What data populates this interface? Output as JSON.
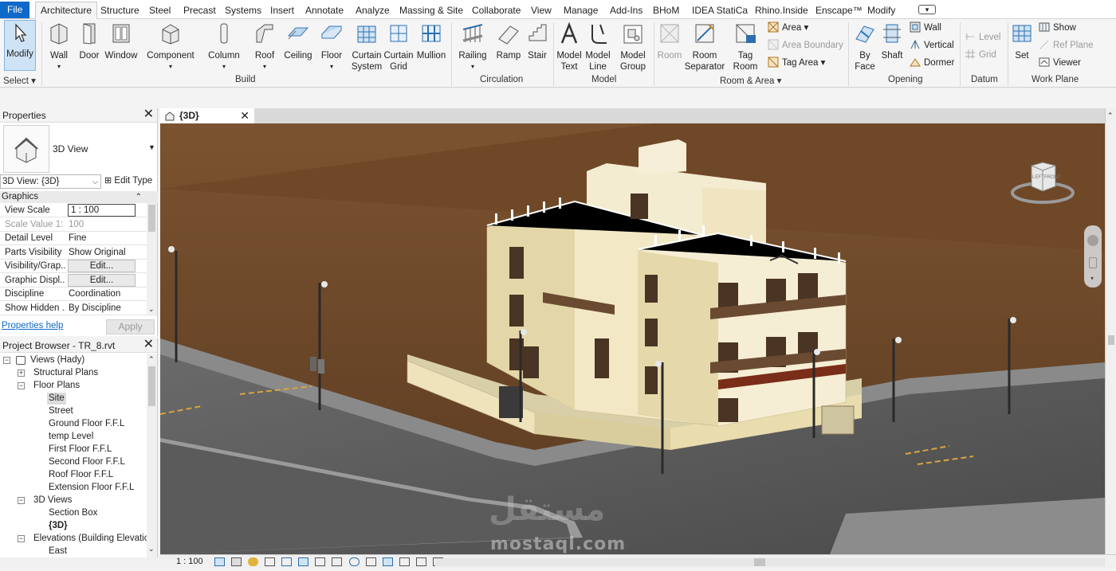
{
  "menubar": {
    "tabs": [
      "File",
      "Architecture",
      "Structure",
      "Steel",
      "Precast",
      "Systems",
      "Insert",
      "Annotate",
      "Analyze",
      "Massing & Site",
      "Collaborate",
      "View",
      "Manage",
      "Add-Ins",
      "BHoM",
      "IDEA StatiCa",
      "Rhino.Inside",
      "Enscape™",
      "Modify"
    ]
  },
  "ribbon": {
    "select": {
      "modify_label": "Modify",
      "select_label": "Select"
    },
    "build": {
      "title": "Build",
      "wall": "Wall",
      "door": "Door",
      "window": "Window",
      "component": "Component",
      "column": "Column",
      "roof": "Roof",
      "ceiling": "Ceiling",
      "floor": "Floor",
      "curtain_system_1": "Curtain",
      "curtain_system_2": "System",
      "curtain_grid_1": "Curtain",
      "curtain_grid_2": "Grid",
      "mullion": "Mullion"
    },
    "circulation": {
      "title": "Circulation",
      "railing": "Railing",
      "ramp": "Ramp",
      "stair": "Stair"
    },
    "model": {
      "title": "Model",
      "model_text_1": "Model",
      "model_text_2": "Text",
      "model_line_1": "Model",
      "model_line_2": "Line",
      "model_group_1": "Model",
      "model_group_2": "Group"
    },
    "room_area": {
      "title": "Room & Area",
      "room": "Room",
      "room_sep_1": "Room",
      "room_sep_2": "Separator",
      "tag_room_1": "Tag",
      "tag_room_2": "Room",
      "area": "Area",
      "area_boundary": "Area  Boundary",
      "tag_area": "Tag  Area"
    },
    "opening": {
      "title": "Opening",
      "by_face_1": "By",
      "by_face_2": "Face",
      "shaft": "Shaft",
      "wall": "Wall",
      "vertical": "Vertical",
      "dormer": "Dormer"
    },
    "datum": {
      "title": "Datum",
      "level": "Level",
      "grid": "Grid"
    },
    "work_plane": {
      "title": "Work Plane",
      "set": "Set",
      "show": "Show",
      "ref_plane": "Ref  Plane",
      "viewer": "Viewer"
    }
  },
  "properties": {
    "title": "Properties",
    "type_name": "3D View",
    "view_selector": "3D View: {3D}",
    "edit_type": "Edit Type",
    "section": "Graphics",
    "rows": [
      {
        "k": "View Scale",
        "v": "1 : 100",
        "kind": "input"
      },
      {
        "k": "Scale Value   1:",
        "v": "100",
        "kind": "dim"
      },
      {
        "k": "Detail Level",
        "v": "Fine",
        "kind": "text"
      },
      {
        "k": "Parts Visibility",
        "v": "Show Original",
        "kind": "text"
      },
      {
        "k": "Visibility/Grap...",
        "v": "Edit...",
        "kind": "button"
      },
      {
        "k": "Graphic Displ...",
        "v": "Edit...",
        "kind": "button"
      },
      {
        "k": "Discipline",
        "v": "Coordination",
        "kind": "text"
      },
      {
        "k": "Show Hidden ...",
        "v": "By Discipline",
        "kind": "text"
      }
    ],
    "help_link": "Properties help",
    "apply": "Apply"
  },
  "browser": {
    "title": "Project Browser - TR_8.rvt",
    "nodes": [
      {
        "label": "Views (Hady)",
        "depth": 0,
        "toggle": "-",
        "icon": true
      },
      {
        "label": "Structural Plans",
        "depth": 1,
        "toggle": "+"
      },
      {
        "label": "Floor Plans",
        "depth": 1,
        "toggle": "-"
      },
      {
        "label": "Site",
        "depth": 2,
        "selected": true
      },
      {
        "label": "Street",
        "depth": 2
      },
      {
        "label": "Ground Floor F.F.L",
        "depth": 2
      },
      {
        "label": "temp Level",
        "depth": 2
      },
      {
        "label": "First Floor F.F.L",
        "depth": 2
      },
      {
        "label": "Second Floor F.F.L",
        "depth": 2
      },
      {
        "label": "Roof Floor F.F.L",
        "depth": 2
      },
      {
        "label": "Extension Floor F.F.L",
        "depth": 2
      },
      {
        "label": "3D Views",
        "depth": 1,
        "toggle": "-"
      },
      {
        "label": "Section Box",
        "depth": 2
      },
      {
        "label": "{3D}",
        "depth": 2,
        "bold": true
      },
      {
        "label": "Elevations (Building Elevatio",
        "depth": 1,
        "toggle": "-"
      },
      {
        "label": "East",
        "depth": 2
      }
    ]
  },
  "view": {
    "tab_label": "{3D}",
    "viewcube_left": "LEFT",
    "viewcube_front": "FRONT",
    "watermark_arabic": "مستقل",
    "watermark_latin": "mostaql.com"
  },
  "status": {
    "scale": "1 : 100"
  },
  "colors": {
    "file_tab": "#0f69c8",
    "ground": "#6a4526",
    "road": "#5c5c5c",
    "building": "#efe6c6",
    "selection": "#cfe3f6"
  }
}
